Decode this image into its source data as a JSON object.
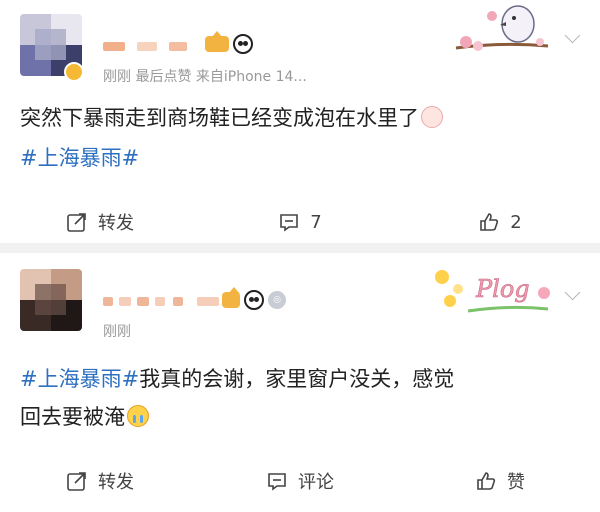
{
  "posts": [
    {
      "meta": "刚刚  最后点赞  来自iPhone 14...",
      "text_main": "突然下暴雨走到商场鞋已经变成泡在水里了",
      "hashtag": "#上海暴雨#",
      "actions": {
        "repost": "转发",
        "comment": "7",
        "like": "2"
      }
    },
    {
      "meta": "刚刚",
      "hashtag": "#上海暴雨#",
      "text_line1": "我真的会谢，家里窗户没关，感觉",
      "text_line2": "回去要被淹",
      "actions": {
        "repost": "转发",
        "comment": "评论",
        "like": "赞"
      }
    }
  ],
  "decor": {
    "plog_label": "Plog"
  },
  "icons": [
    "verified-badge-icon",
    "crown-badge-icon",
    "panda-icon",
    "medal-icon",
    "chevron-down-icon",
    "repost-icon",
    "comment-icon",
    "like-icon",
    "crying-face-icon",
    "blush-face-icon",
    "bird-sticker-icon",
    "plog-sticker-icon"
  ]
}
